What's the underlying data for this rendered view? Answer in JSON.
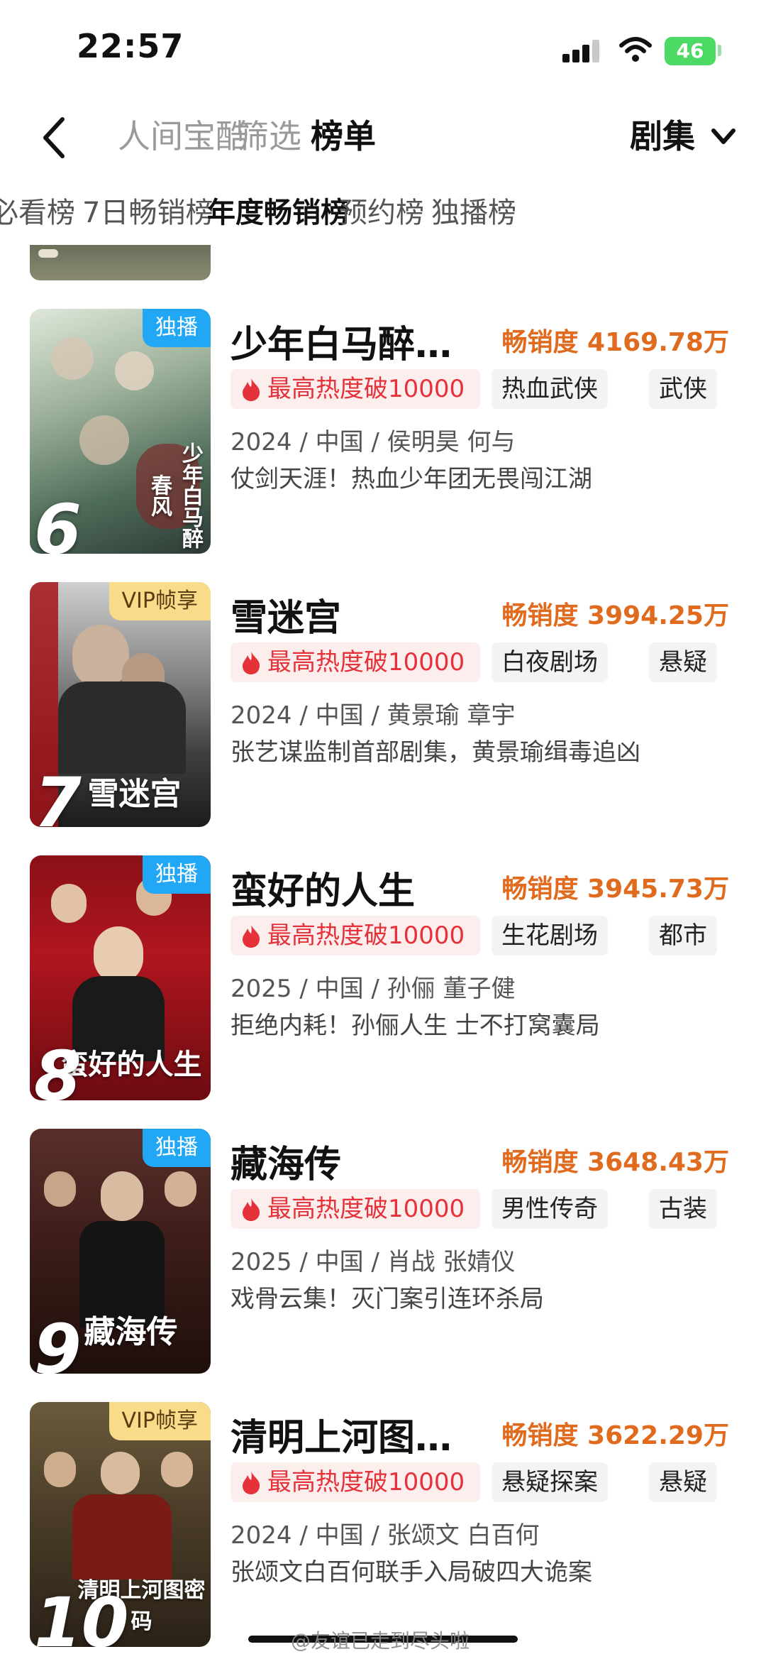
{
  "status": {
    "time": "22:57",
    "battery": "46"
  },
  "header": {
    "tabs": [
      "人间宝酷",
      "筛选",
      "榜单"
    ],
    "dropdown": "剧集"
  },
  "subtabs": [
    "必看榜",
    "7日畅销榜",
    "年度畅销榜",
    "预约榜",
    "独播榜"
  ],
  "colors": {
    "accent": "#e06b1e",
    "hot": "#e5323a",
    "badge_blue": "#21a7f4",
    "badge_gold": "#f8dc8a"
  },
  "items": [
    {
      "rank": "6",
      "badge": "独播",
      "title": "少年白马醉…",
      "poster_text": "少年白马醉春风",
      "sales_label": "畅销度",
      "sales_value": "4169.78万",
      "hot": "最高热度破10000",
      "tags": [
        "热血武侠",
        "武侠"
      ],
      "meta": "2024 / 中国 / 侯明昊 何与",
      "desc": "仗剑天涯！热血少年团无畏闯江湖"
    },
    {
      "rank": "7",
      "badge": "VIP帧享",
      "title": "雪迷宫",
      "poster_text": "雪迷宫",
      "sales_label": "畅销度",
      "sales_value": "3994.25万",
      "hot": "最高热度破10000",
      "tags": [
        "白夜剧场",
        "悬疑"
      ],
      "meta": "2024 / 中国 / 黄景瑜 章宇",
      "desc": "张艺谋监制首部剧集，黄景瑜缉毒追凶"
    },
    {
      "rank": "8",
      "badge": "独播",
      "title": "蛮好的人生",
      "poster_text": "蛮好的人生",
      "sales_label": "畅销度",
      "sales_value": "3945.73万",
      "hot": "最高热度破10000",
      "tags": [
        "生花剧场",
        "都市"
      ],
      "meta": "2025 / 中国 / 孙俪 董子健",
      "desc": "拒绝内耗！孙俪人生 士不打窝囊局"
    },
    {
      "rank": "9",
      "badge": "独播",
      "title": "藏海传",
      "poster_text": "藏海传",
      "sales_label": "畅销度",
      "sales_value": "3648.43万",
      "hot": "最高热度破10000",
      "tags": [
        "男性传奇",
        "古装"
      ],
      "meta": "2025 / 中国 / 肖战 张婧仪",
      "desc": "戏骨云集！灭门案引连环杀局"
    },
    {
      "rank": "10",
      "badge": "VIP帧享",
      "title": "清明上河图…",
      "poster_text": "清明上河图密码",
      "sales_label": "畅销度",
      "sales_value": "3622.29万",
      "hot": "最高热度破10000",
      "tags": [
        "悬疑探案",
        "悬疑"
      ],
      "meta": "2024 / 中国 / 张颂文 白百何",
      "desc": "张颂文白百何联手入局破四大诡案"
    }
  ],
  "watermark": "@友谊已走到尽头啦"
}
